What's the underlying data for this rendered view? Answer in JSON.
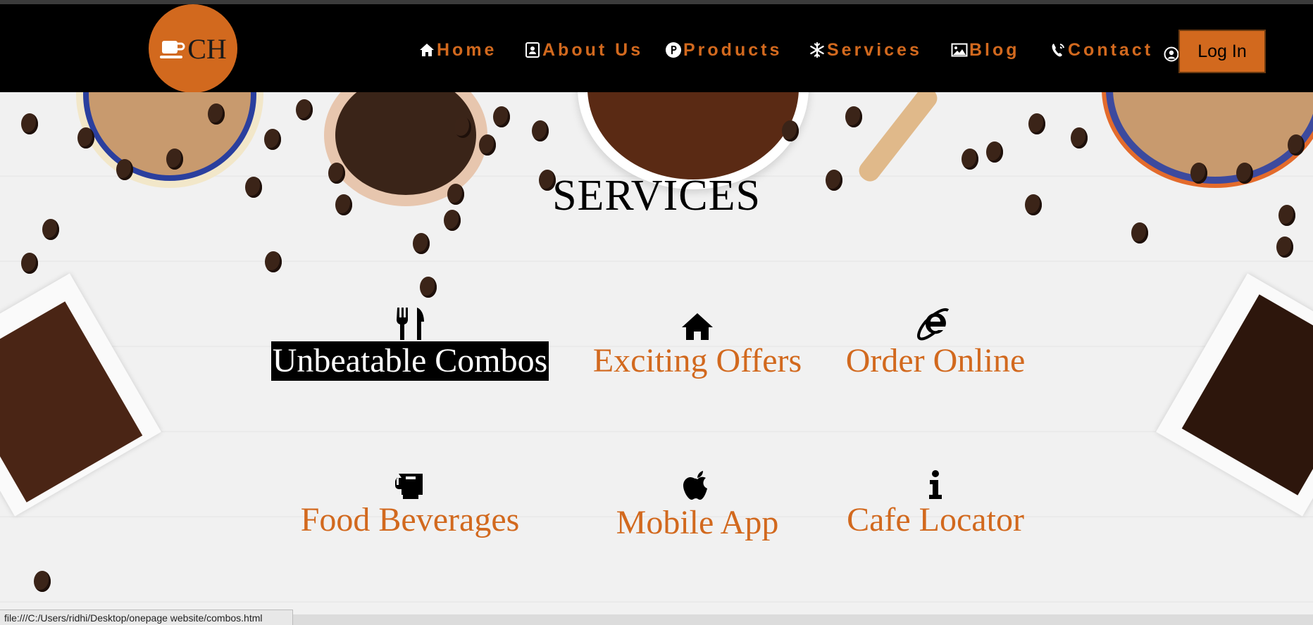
{
  "brand": {
    "logo_text": "CH",
    "accent_color": "#d2691e"
  },
  "nav": {
    "items": [
      {
        "label": "Home",
        "icon": "home-icon"
      },
      {
        "label": "About Us",
        "icon": "contact-card-icon"
      },
      {
        "label": "Products",
        "icon": "p-circle-icon"
      },
      {
        "label": "Services",
        "icon": "snowflake-icon"
      },
      {
        "label": "Blog",
        "icon": "picture-icon"
      },
      {
        "label": "Contact",
        "icon": "phone-icon"
      }
    ],
    "login_label": "Log In"
  },
  "services": {
    "title": "SERVICES",
    "items": [
      {
        "label": "Unbeatable Combos",
        "icon": "cutlery-icon",
        "selected": true
      },
      {
        "label": "Exciting Offers",
        "icon": "home-icon",
        "selected": false
      },
      {
        "label": "Order Online",
        "icon": "internet-explorer-icon",
        "selected": false
      },
      {
        "label": "Food Beverages",
        "icon": "mug-icon",
        "selected": false
      },
      {
        "label": "Mobile App",
        "icon": "apple-icon",
        "selected": false
      },
      {
        "label": "Cafe Locator",
        "icon": "info-icon",
        "selected": false
      }
    ]
  },
  "status_bar": {
    "url": "file:///C:/Users/ridhi/Desktop/onepage website/combos.html"
  }
}
